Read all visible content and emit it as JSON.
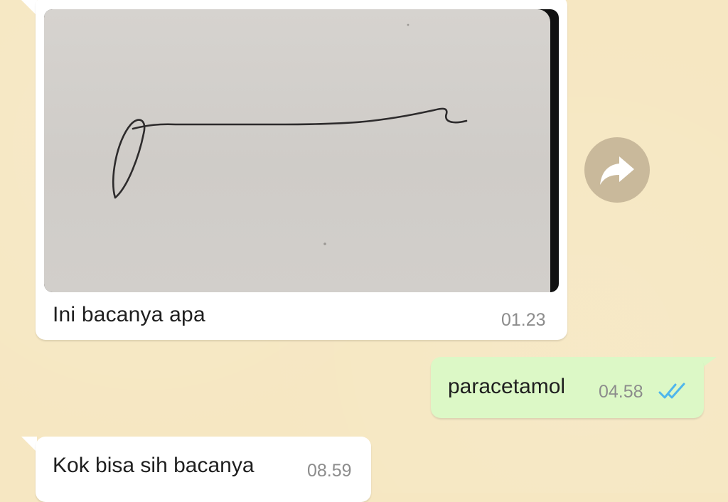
{
  "messages": {
    "image_message": {
      "caption": "Ini bacanya apa",
      "time": "01.23"
    },
    "outgoing_message": {
      "text": "paracetamol",
      "time": "04.58",
      "status": "read"
    },
    "incoming_text_message": {
      "text": "Kok bisa sih bacanya",
      "time": "08.59"
    }
  },
  "icons": {
    "forward": "forward-icon",
    "read_receipt": "double-check-icon"
  },
  "colors": {
    "chat_background": "#f6e7c2",
    "incoming_bubble": "#ffffff",
    "outgoing_bubble": "#dcf8c6",
    "timestamp": "#8c8c8c",
    "read_ticks": "#4fb6ec",
    "forward_button": "#c9b99b"
  }
}
